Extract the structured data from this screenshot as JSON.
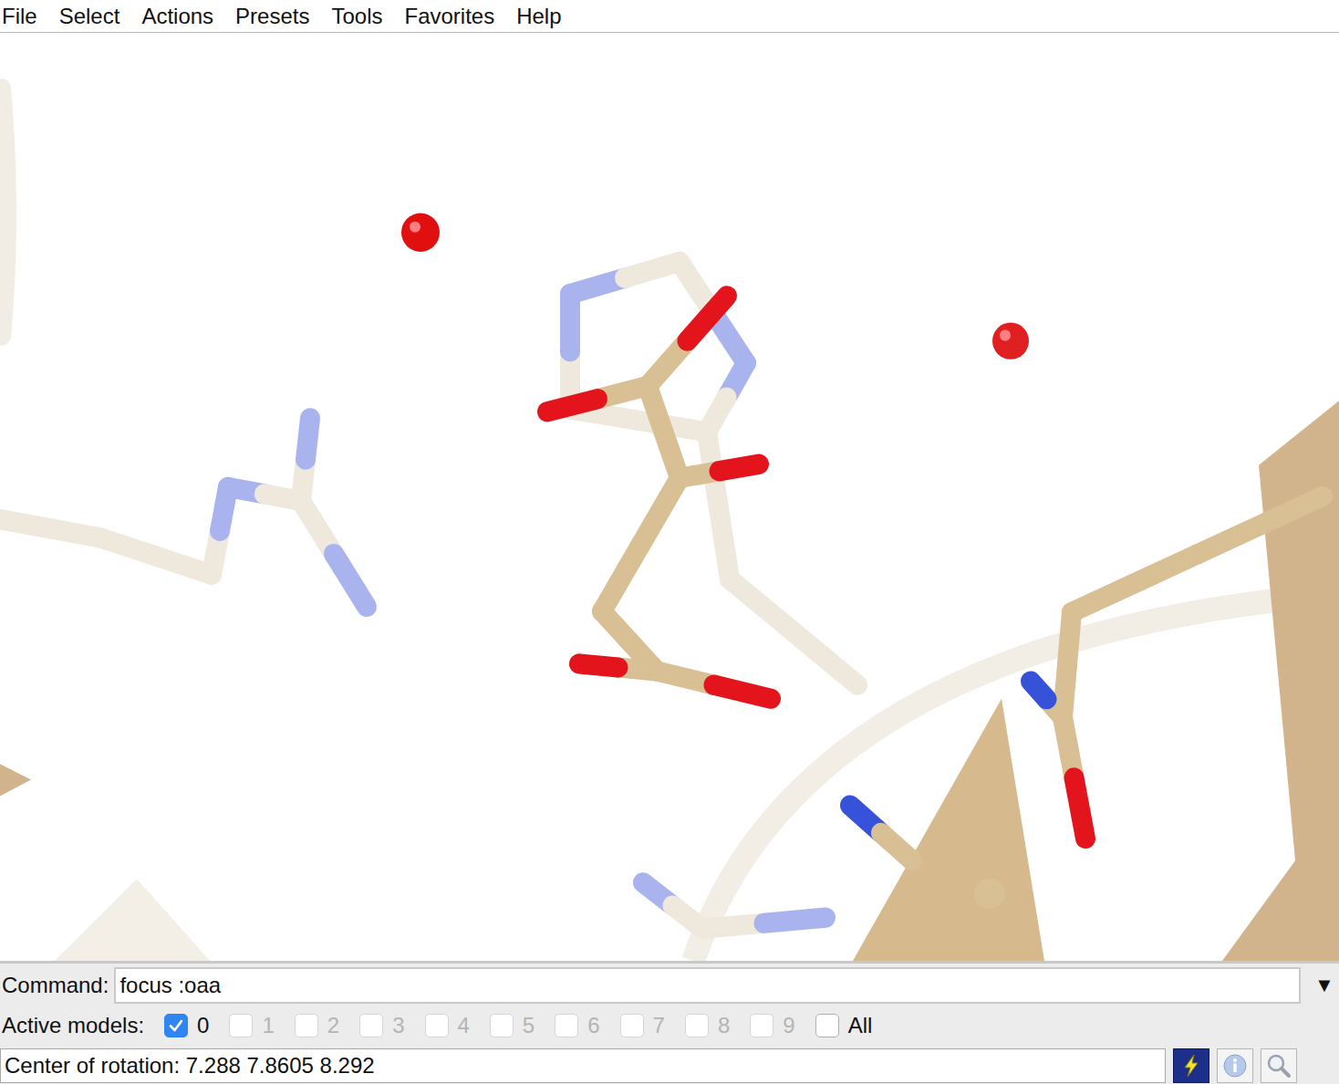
{
  "window": {
    "app": "UCSF Chimera"
  },
  "menu": [
    "File",
    "Select",
    "Actions",
    "Presets",
    "Tools",
    "Favorites",
    "Help"
  ],
  "command": {
    "label": "Command:",
    "value": "focus :oaa",
    "dropdown": "▼"
  },
  "active_models": {
    "label": "Active models:",
    "models": [
      {
        "label": "0",
        "checked": true,
        "disabled": false
      },
      {
        "label": "1",
        "checked": false,
        "disabled": true
      },
      {
        "label": "2",
        "checked": false,
        "disabled": true
      },
      {
        "label": "3",
        "checked": false,
        "disabled": true
      },
      {
        "label": "4",
        "checked": false,
        "disabled": true
      },
      {
        "label": "5",
        "checked": false,
        "disabled": true
      },
      {
        "label": "6",
        "checked": false,
        "disabled": true
      },
      {
        "label": "7",
        "checked": false,
        "disabled": true
      },
      {
        "label": "8",
        "checked": false,
        "disabled": true
      },
      {
        "label": "9",
        "checked": false,
        "disabled": true
      }
    ],
    "all": {
      "label": "All",
      "checked": false,
      "disabled": false
    }
  },
  "status": {
    "text": "Center of rotation: 7.288 7.8605 8.292"
  }
}
